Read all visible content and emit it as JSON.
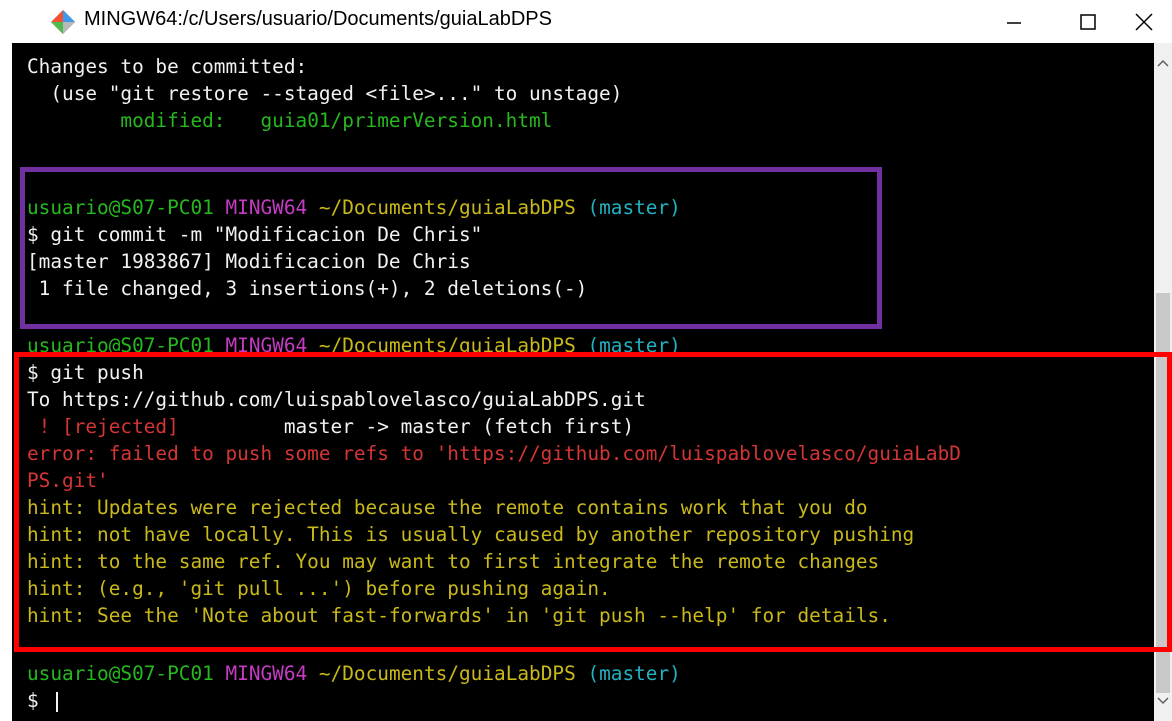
{
  "window": {
    "title": "MINGW64:/c/Users/usuario/Documents/guiaLabDPS",
    "minimize_icon": "minimize-icon",
    "maximize_icon": "maximize-icon",
    "close_icon": "close-icon"
  },
  "terminal": {
    "line01": "Changes to be committed:",
    "line02": "  (use \"git restore --staged <file>...\" to unstage)",
    "line03a": "        modified:",
    "line03b": "   guia01/primerVersion.html",
    "prompt1": {
      "user": "usuario@S07-PC01",
      "shell": "MINGW64",
      "path": "~/Documents/guiaLabDPS",
      "branch": "(master)"
    },
    "cmd1": "$ git commit -m \"Modificacion De Chris\"",
    "out1": "[master 1983867] Modificacion De Chris",
    "out2": " 1 file changed, 3 insertions(+), 2 deletions(-)",
    "prompt2": {
      "user": "usuario@S07-PC01",
      "shell": "MINGW64",
      "path": "~/Documents/guiaLabDPS",
      "branch": "(master)"
    },
    "cmd2": "$ git push",
    "push_to": "To https://github.com/luispablovelasco/guiaLabDPS.git",
    "rejected_a": " ! [rejected]",
    "rejected_b": "         master -> master (fetch first)",
    "error1": "error: failed to push some refs to 'https://github.com/luispablovelasco/guiaLabD",
    "error2": "PS.git'",
    "hint1": "hint: Updates were rejected because the remote contains work that you do",
    "hint2": "hint: not have locally. This is usually caused by another repository pushing",
    "hint3": "hint: to the same ref. You may want to first integrate the remote changes",
    "hint4": "hint: (e.g., 'git pull ...') before pushing again.",
    "hint5": "hint: See the 'Note about fast-forwards' in 'git push --help' for details.",
    "prompt3": {
      "user": "usuario@S07-PC01",
      "shell": "MINGW64",
      "path": "~/Documents/guiaLabDPS",
      "branch": "(master)"
    },
    "cmd3": "$ "
  },
  "colors": {
    "purple_box": "#7030a0",
    "red_box": "#ff0000",
    "prompt_user": "#26b81f",
    "prompt_shell": "#c43bc4",
    "prompt_path": "#c9b91a",
    "prompt_branch": "#22b2c2",
    "error": "#d43535",
    "hint": "#c9b91a"
  }
}
